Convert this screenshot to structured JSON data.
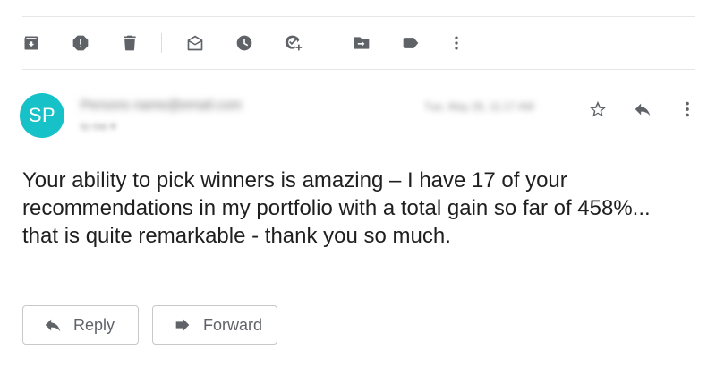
{
  "toolbar": {
    "icons": [
      "archive-icon",
      "report-spam-icon",
      "delete-icon",
      "mark-unread-icon",
      "snooze-icon",
      "add-to-tasks-icon",
      "move-to-icon",
      "labels-icon",
      "more-vert-icon"
    ]
  },
  "message": {
    "avatar_initials": "SP",
    "avatar_color": "#16c1c8",
    "sender": "Persons name@email.com",
    "recipient": "to me ▾",
    "date": "Tue, May 26, 11:17 AM",
    "body": "Your ability to pick winners is amazing – I have 17 of your recommendations in my portfolio with a total gain so far of 458%... that is quite remarkable - thank you so much."
  },
  "actions": {
    "reply_label": "Reply",
    "forward_label": "Forward"
  }
}
